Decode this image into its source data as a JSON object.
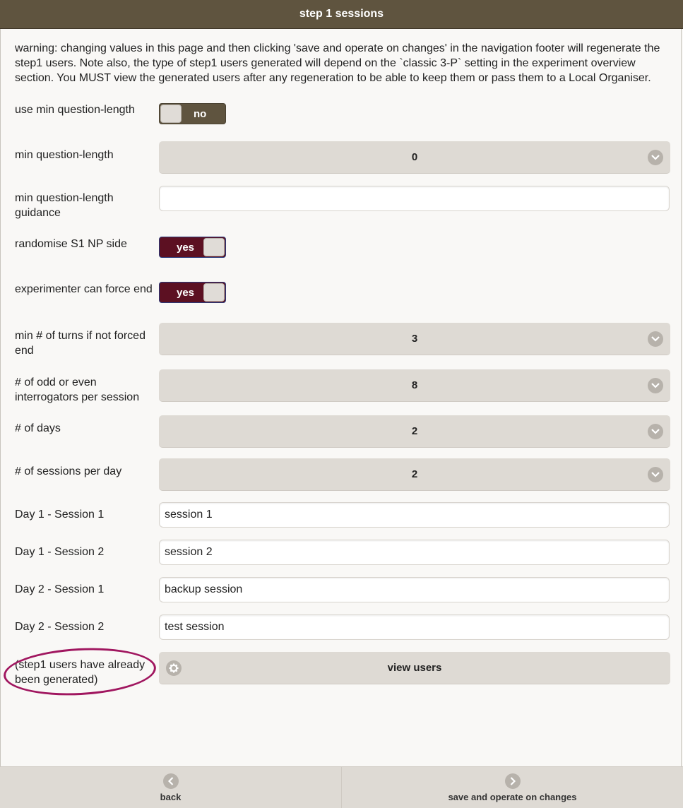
{
  "header": {
    "title": "step 1 sessions"
  },
  "warning": "warning: changing values in this page and then clicking 'save and operate on changes' in the navigation footer will regenerate the step1 users. Note also, the type of step1 users generated will depend on the `classic 3-P` setting in the experiment overview section. You MUST view the generated users after any regeneration to be able to keep them or pass them to a Local Organiser.",
  "fields": {
    "use_min_question_length": {
      "label": "use min question-length",
      "value": "no"
    },
    "min_question_length": {
      "label": "min question-length",
      "value": "0"
    },
    "min_question_length_guidance": {
      "label": "min question-length guidance",
      "value": ""
    },
    "randomise_s1_np_side": {
      "label": "randomise S1 NP side",
      "value": "yes"
    },
    "experimenter_can_force_end": {
      "label": "experimenter can force end",
      "value": "yes"
    },
    "min_turns_if_not_forced_end": {
      "label": "min # of turns if not forced end",
      "value": "3"
    },
    "odd_even_interrogators": {
      "label": "# of odd or even interrogators per session",
      "value": "8"
    },
    "num_days": {
      "label": "# of days",
      "value": "2"
    },
    "sessions_per_day": {
      "label": "# of sessions per day",
      "value": "2"
    }
  },
  "sessions": [
    {
      "label": "Day 1 - Session 1",
      "value": "session 1"
    },
    {
      "label": "Day 1 - Session 2",
      "value": "session 2"
    },
    {
      "label": "Day 2 - Session 1",
      "value": "backup session"
    },
    {
      "label": "Day 2 - Session 2",
      "value": "test session"
    }
  ],
  "users": {
    "status": "(step1 users have already been generated)",
    "button_label": "view users"
  },
  "footer": {
    "back_label": "back",
    "save_label": "save and operate on changes"
  },
  "colors": {
    "header": "#5f543f",
    "toggle_on": "#5c1022",
    "annotation": "#a0165f"
  }
}
